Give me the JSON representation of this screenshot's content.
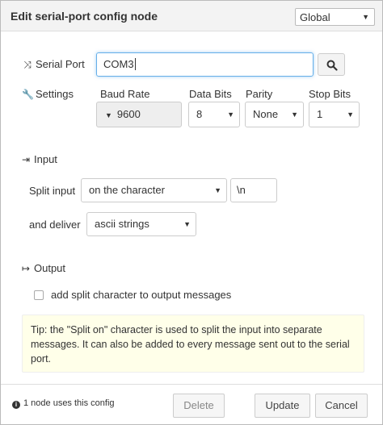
{
  "header": {
    "title": "Edit serial-port config node",
    "scope": "Global"
  },
  "serial_port": {
    "label": "Serial Port",
    "value": "COM3"
  },
  "settings": {
    "label": "Settings",
    "baud_rate": {
      "label": "Baud Rate",
      "value": "9600"
    },
    "data_bits": {
      "label": "Data Bits",
      "value": "8"
    },
    "parity": {
      "label": "Parity",
      "value": "None"
    },
    "stop_bits": {
      "label": "Stop Bits",
      "value": "1"
    }
  },
  "input": {
    "title": "Input",
    "split_label": "Split input",
    "split_mode": "on the character",
    "split_char": "\\n",
    "deliver_label": "and deliver",
    "deliver_value": "ascii strings"
  },
  "output": {
    "title": "Output",
    "add_split_label": "add split character to output messages"
  },
  "tip": "Tip: the \"Split on\" character is used to split the input into separate messages. It can also be added to every message sent out to the serial port.",
  "footer": {
    "usage": "1 node uses this config",
    "delete_label": "Delete",
    "update_label": "Update",
    "cancel_label": "Cancel"
  }
}
